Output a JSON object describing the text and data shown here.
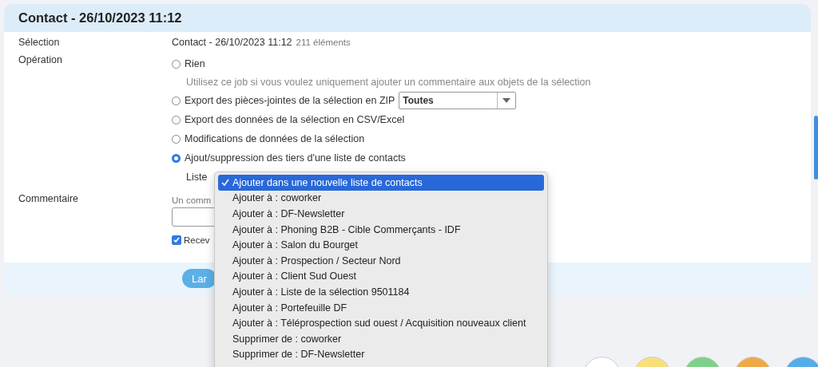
{
  "panel": {
    "title": "Contact - 26/10/2023 11:12"
  },
  "selection": {
    "label": "Sélection",
    "value": "Contact - 26/10/2023 11:12",
    "count": "211 éléments"
  },
  "operation": {
    "label": "Opération",
    "options": [
      {
        "label": "Rien",
        "selected": false,
        "hint": "Utilisez ce job si vous voulez uniquement ajouter un commentaire aux objets de la sélection"
      },
      {
        "label": "Export des pièces-jointes de la sélection en ZIP",
        "selected": false,
        "select": "Toutes"
      },
      {
        "label": "Export des données de la sélection en CSV/Excel",
        "selected": false
      },
      {
        "label": "Modifications de données de la sélection",
        "selected": false
      },
      {
        "label": "Ajout/suppression des tiers d'une liste de contacts",
        "selected": true
      }
    ],
    "list_label": "Liste"
  },
  "comment": {
    "label": "Commentaire",
    "hint": "Un comm",
    "receive_label": "Recev",
    "receive_checked": true
  },
  "launch_button": "Lar",
  "dropdown": [
    {
      "label": "Ajouter dans une nouvelle liste de contacts",
      "selected": true
    },
    {
      "label": "Ajouter à : coworker",
      "selected": false
    },
    {
      "label": "Ajouter à : DF-Newsletter",
      "selected": false
    },
    {
      "label": "Ajouter à : Phoning B2B - Cible Commerçants - IDF",
      "selected": false
    },
    {
      "label": "Ajouter à : Salon du Bourget",
      "selected": false
    },
    {
      "label": "Ajouter à : Prospection / Secteur Nord",
      "selected": false
    },
    {
      "label": "Ajouter à : Client Sud Ouest",
      "selected": false
    },
    {
      "label": "Ajouter à : Liste de la sélection 9501184",
      "selected": false
    },
    {
      "label": "Ajouter à : Portefeuille DF",
      "selected": false
    },
    {
      "label": "Ajouter à : Téléprospection sud ouest / Acquisition nouveaux client",
      "selected": false
    },
    {
      "label": "Supprimer de : coworker",
      "selected": false
    },
    {
      "label": "Supprimer de : DF-Newsletter",
      "selected": false
    }
  ],
  "swatches": [
    {
      "color": "#ffffff"
    },
    {
      "color": "#f7e07a"
    },
    {
      "color": "#7fd18a"
    },
    {
      "color": "#eeaa48"
    },
    {
      "color": "#56ace8"
    }
  ]
}
